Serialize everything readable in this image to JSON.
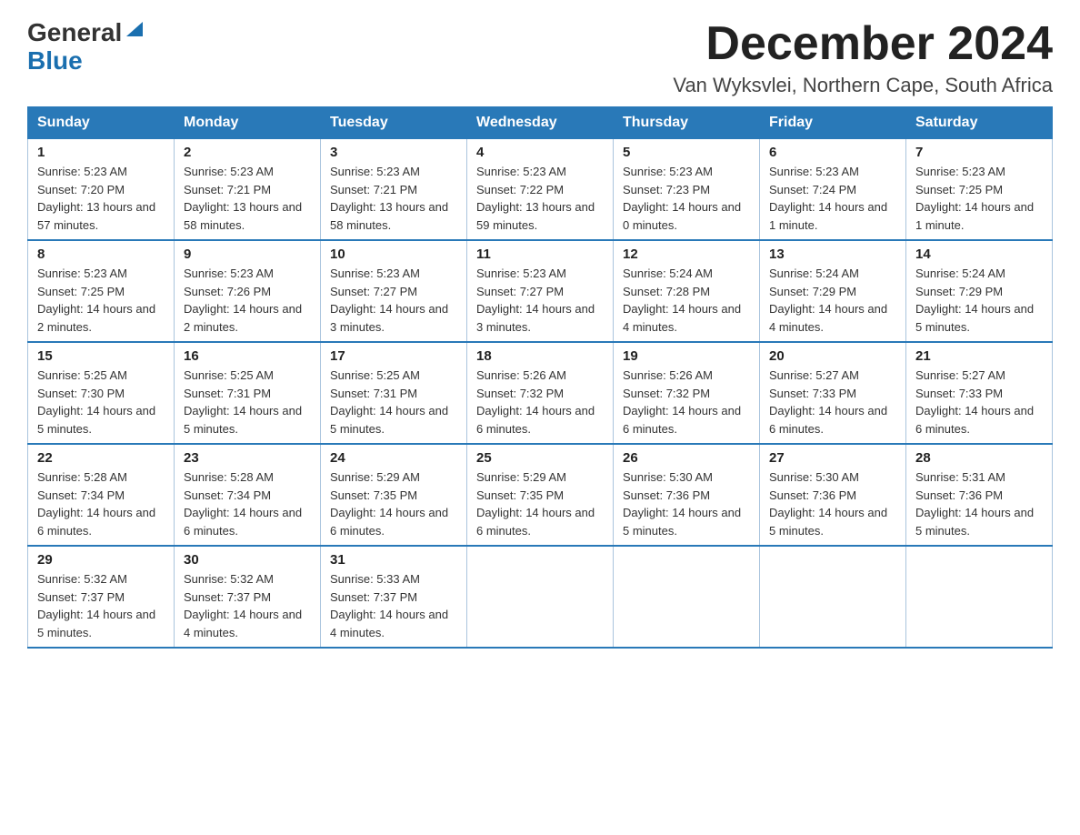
{
  "header": {
    "logo_line1": "General",
    "logo_line2": "Blue",
    "month_title": "December 2024",
    "location": "Van Wyksvlei, Northern Cape, South Africa"
  },
  "days_of_week": [
    "Sunday",
    "Monday",
    "Tuesday",
    "Wednesday",
    "Thursday",
    "Friday",
    "Saturday"
  ],
  "weeks": [
    [
      {
        "day": "1",
        "sunrise": "5:23 AM",
        "sunset": "7:20 PM",
        "daylight": "13 hours and 57 minutes."
      },
      {
        "day": "2",
        "sunrise": "5:23 AM",
        "sunset": "7:21 PM",
        "daylight": "13 hours and 58 minutes."
      },
      {
        "day": "3",
        "sunrise": "5:23 AM",
        "sunset": "7:21 PM",
        "daylight": "13 hours and 58 minutes."
      },
      {
        "day": "4",
        "sunrise": "5:23 AM",
        "sunset": "7:22 PM",
        "daylight": "13 hours and 59 minutes."
      },
      {
        "day": "5",
        "sunrise": "5:23 AM",
        "sunset": "7:23 PM",
        "daylight": "14 hours and 0 minutes."
      },
      {
        "day": "6",
        "sunrise": "5:23 AM",
        "sunset": "7:24 PM",
        "daylight": "14 hours and 1 minute."
      },
      {
        "day": "7",
        "sunrise": "5:23 AM",
        "sunset": "7:25 PM",
        "daylight": "14 hours and 1 minute."
      }
    ],
    [
      {
        "day": "8",
        "sunrise": "5:23 AM",
        "sunset": "7:25 PM",
        "daylight": "14 hours and 2 minutes."
      },
      {
        "day": "9",
        "sunrise": "5:23 AM",
        "sunset": "7:26 PM",
        "daylight": "14 hours and 2 minutes."
      },
      {
        "day": "10",
        "sunrise": "5:23 AM",
        "sunset": "7:27 PM",
        "daylight": "14 hours and 3 minutes."
      },
      {
        "day": "11",
        "sunrise": "5:23 AM",
        "sunset": "7:27 PM",
        "daylight": "14 hours and 3 minutes."
      },
      {
        "day": "12",
        "sunrise": "5:24 AM",
        "sunset": "7:28 PM",
        "daylight": "14 hours and 4 minutes."
      },
      {
        "day": "13",
        "sunrise": "5:24 AM",
        "sunset": "7:29 PM",
        "daylight": "14 hours and 4 minutes."
      },
      {
        "day": "14",
        "sunrise": "5:24 AM",
        "sunset": "7:29 PM",
        "daylight": "14 hours and 5 minutes."
      }
    ],
    [
      {
        "day": "15",
        "sunrise": "5:25 AM",
        "sunset": "7:30 PM",
        "daylight": "14 hours and 5 minutes."
      },
      {
        "day": "16",
        "sunrise": "5:25 AM",
        "sunset": "7:31 PM",
        "daylight": "14 hours and 5 minutes."
      },
      {
        "day": "17",
        "sunrise": "5:25 AM",
        "sunset": "7:31 PM",
        "daylight": "14 hours and 5 minutes."
      },
      {
        "day": "18",
        "sunrise": "5:26 AM",
        "sunset": "7:32 PM",
        "daylight": "14 hours and 6 minutes."
      },
      {
        "day": "19",
        "sunrise": "5:26 AM",
        "sunset": "7:32 PM",
        "daylight": "14 hours and 6 minutes."
      },
      {
        "day": "20",
        "sunrise": "5:27 AM",
        "sunset": "7:33 PM",
        "daylight": "14 hours and 6 minutes."
      },
      {
        "day": "21",
        "sunrise": "5:27 AM",
        "sunset": "7:33 PM",
        "daylight": "14 hours and 6 minutes."
      }
    ],
    [
      {
        "day": "22",
        "sunrise": "5:28 AM",
        "sunset": "7:34 PM",
        "daylight": "14 hours and 6 minutes."
      },
      {
        "day": "23",
        "sunrise": "5:28 AM",
        "sunset": "7:34 PM",
        "daylight": "14 hours and 6 minutes."
      },
      {
        "day": "24",
        "sunrise": "5:29 AM",
        "sunset": "7:35 PM",
        "daylight": "14 hours and 6 minutes."
      },
      {
        "day": "25",
        "sunrise": "5:29 AM",
        "sunset": "7:35 PM",
        "daylight": "14 hours and 6 minutes."
      },
      {
        "day": "26",
        "sunrise": "5:30 AM",
        "sunset": "7:36 PM",
        "daylight": "14 hours and 5 minutes."
      },
      {
        "day": "27",
        "sunrise": "5:30 AM",
        "sunset": "7:36 PM",
        "daylight": "14 hours and 5 minutes."
      },
      {
        "day": "28",
        "sunrise": "5:31 AM",
        "sunset": "7:36 PM",
        "daylight": "14 hours and 5 minutes."
      }
    ],
    [
      {
        "day": "29",
        "sunrise": "5:32 AM",
        "sunset": "7:37 PM",
        "daylight": "14 hours and 5 minutes."
      },
      {
        "day": "30",
        "sunrise": "5:32 AM",
        "sunset": "7:37 PM",
        "daylight": "14 hours and 4 minutes."
      },
      {
        "day": "31",
        "sunrise": "5:33 AM",
        "sunset": "7:37 PM",
        "daylight": "14 hours and 4 minutes."
      },
      null,
      null,
      null,
      null
    ]
  ]
}
